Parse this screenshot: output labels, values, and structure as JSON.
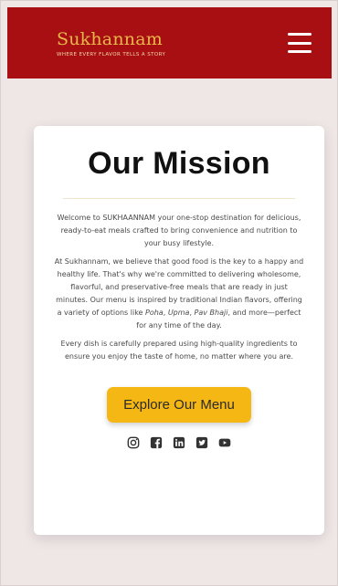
{
  "header": {
    "logo_title": "Sukhannam",
    "logo_tagline": "Where every flavor tells a story",
    "menu_icon": "hamburger-menu-icon",
    "brand_color": "#a80f12",
    "logo_color": "#e9b64a"
  },
  "mission": {
    "title": "Our Mission",
    "p1": "Welcome to SUKHAANNAM your one-stop destination for delicious, ready-to-eat meals crafted to bring convenience and nutrition to your busy lifestyle.",
    "p2_a": "At Sukhannam, we believe that good food is the key to a happy and healthy life. That's why we're committed to delivering wholesome, flavorful, and preservative-free meals that are ready in just minutes. Our menu is inspired by traditional Indian flavors, offering a variety of options like ",
    "p2_poha": "Poha",
    "p2_sep1": ", ",
    "p2_upma": "Upma",
    "p2_sep2": ", ",
    "p2_pavbhaji": "Pav Bhaji",
    "p2_b": ", and more—perfect for any time of the day.",
    "p3": "Every dish is carefully prepared using high-quality ingredients to ensure you enjoy the taste of home, no matter where you are.",
    "cta_label": "Explore Our Menu",
    "cta_color": "#f5b714"
  },
  "socials": [
    {
      "icon": "instagram-icon"
    },
    {
      "icon": "facebook-icon"
    },
    {
      "icon": "linkedin-icon"
    },
    {
      "icon": "twitter-icon"
    },
    {
      "icon": "youtube-icon"
    }
  ]
}
